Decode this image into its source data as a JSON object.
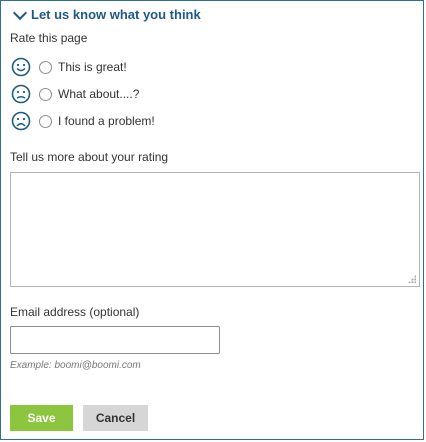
{
  "header": {
    "title": "Let us know what you think"
  },
  "rating": {
    "label": "Rate this page",
    "options": [
      {
        "icon": "smile-face-icon",
        "text": "This is great!"
      },
      {
        "icon": "neutral-face-icon",
        "text": "What about....?"
      },
      {
        "icon": "frown-face-icon",
        "text": "I found a problem!"
      }
    ]
  },
  "feedback": {
    "label": "Tell us more about your rating",
    "value": ""
  },
  "email": {
    "label": "Email address (optional)",
    "value": "",
    "hint": "Example: boomi@boomi.com"
  },
  "buttons": {
    "save": "Save",
    "cancel": "Cancel"
  },
  "colors": {
    "accent": "#1e5a85",
    "save": "#8cc63f",
    "cancel": "#d6d6d6",
    "border": "#2f6f8f"
  }
}
